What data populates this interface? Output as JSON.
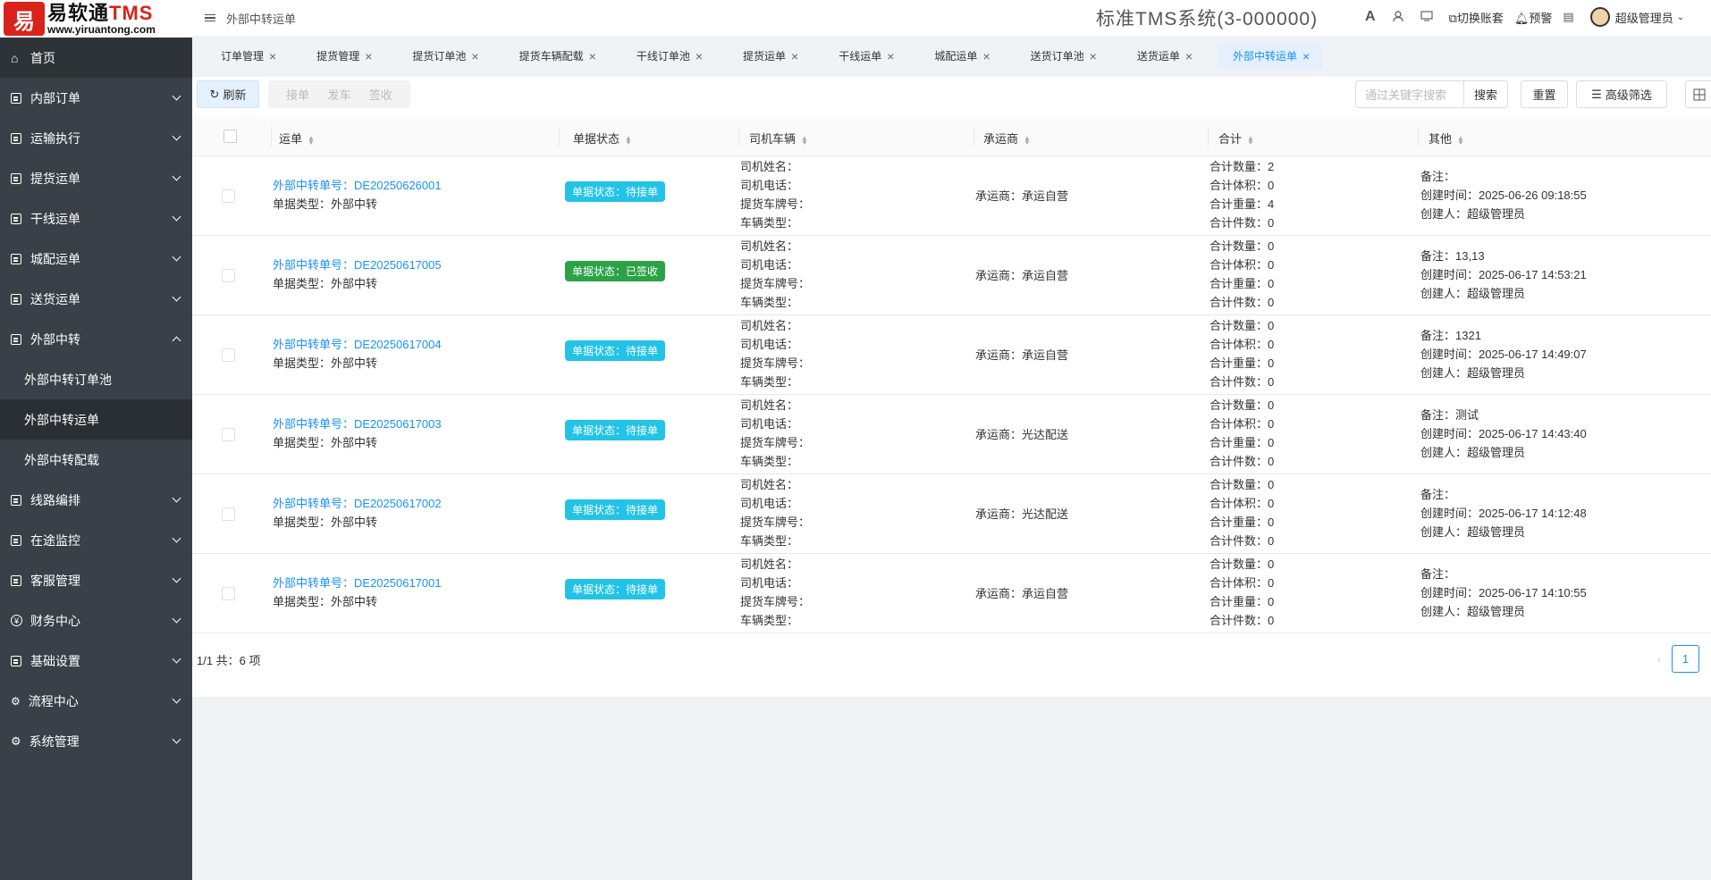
{
  "logo": {
    "mark": "易",
    "name_cn": "易软通",
    "name_en": "TMS",
    "url": "www.yiruantong.com"
  },
  "header": {
    "breadcrumb": "外部中转运单",
    "system_title": "标准TMS系统(3-000000)",
    "font_icon": "A",
    "switch_account": "切换账套",
    "warning": "预警",
    "user": "超级管理员"
  },
  "sidebar": {
    "items": [
      {
        "label": "首页",
        "icon": "home-icon"
      },
      {
        "label": "内部订单",
        "icon": "grid-icon"
      },
      {
        "label": "运输执行",
        "icon": "grid-icon"
      },
      {
        "label": "提货运单",
        "icon": "grid-icon"
      },
      {
        "label": "干线运单",
        "icon": "grid-icon"
      },
      {
        "label": "城配运单",
        "icon": "grid-icon"
      },
      {
        "label": "送货运单",
        "icon": "grid-icon"
      },
      {
        "label": "外部中转",
        "icon": "grid-icon"
      },
      {
        "label": "外部中转订单池"
      },
      {
        "label": "外部中转运单"
      },
      {
        "label": "外部中转配载"
      },
      {
        "label": "线路编排",
        "icon": "grid-icon"
      },
      {
        "label": "在途监控",
        "icon": "grid-icon"
      },
      {
        "label": "客服管理",
        "icon": "grid-icon"
      },
      {
        "label": "财务中心",
        "icon": "yen-icon"
      },
      {
        "label": "基础设置",
        "icon": "grid-icon"
      },
      {
        "label": "流程中心",
        "icon": "flow-icon"
      },
      {
        "label": "系统管理",
        "icon": "gear-icon"
      }
    ]
  },
  "tabs": [
    "订单管理",
    "提货管理",
    "提货订单池",
    "提货车辆配载",
    "干线订单池",
    "提货运单",
    "干线运单",
    "城配运单",
    "送货订单池",
    "送货运单",
    "外部中转运单"
  ],
  "toolbar": {
    "refresh": "刷新",
    "accept": "接单",
    "dispatch": "发车",
    "sign": "签收",
    "search_placeholder": "通过关键字搜索",
    "search": "搜索",
    "reset": "重置",
    "advanced_filter": "高级筛选"
  },
  "table": {
    "headers": [
      "运单",
      "单据状态",
      "司机车辆",
      "承运商",
      "合计",
      "其他"
    ],
    "labels": {
      "order_no": "外部中转单号：",
      "order_type": "单据类型：",
      "driver_name": "司机姓名：",
      "driver_phone": "司机电话：",
      "plate": "提货车牌号：",
      "vehicle_type": "车辆类型：",
      "carrier": "承运商：",
      "qty": "合计数量：",
      "volume": "合计体积：",
      "weight": "合计重量：",
      "pieces": "合计件数：",
      "remark": "备注：",
      "created_at": "创建时间：",
      "creator": "创建人："
    },
    "rows": [
      {
        "no": "DE20250626001",
        "type": "外部中转",
        "status": "单据状态：待接单",
        "carrier": "承运自营",
        "qty": "2",
        "volume": "0",
        "weight": "4",
        "pieces": "0",
        "remark": "",
        "created": "2025-06-26 09:18:55",
        "creator": "超级管理员"
      },
      {
        "no": "DE20250617005",
        "type": "外部中转",
        "status": "单据状态：已签收",
        "carrier": "承运自营",
        "qty": "0",
        "volume": "0",
        "weight": "0",
        "pieces": "0",
        "remark": "13,13",
        "created": "2025-06-17 14:53:21",
        "creator": "超级管理员"
      },
      {
        "no": "DE20250617004",
        "type": "外部中转",
        "status": "单据状态：待接单",
        "carrier": "承运自营",
        "qty": "0",
        "volume": "0",
        "weight": "0",
        "pieces": "0",
        "remark": "1321",
        "created": "2025-06-17 14:49:07",
        "creator": "超级管理员"
      },
      {
        "no": "DE20250617003",
        "type": "外部中转",
        "status": "单据状态：待接单",
        "carrier": "光达配送",
        "qty": "0",
        "volume": "0",
        "weight": "0",
        "pieces": "0",
        "remark": "测试",
        "created": "2025-06-17 14:43:40",
        "creator": "超级管理员"
      },
      {
        "no": "DE20250617002",
        "type": "外部中转",
        "status": "单据状态：待接单",
        "carrier": "光达配送",
        "qty": "0",
        "volume": "0",
        "weight": "0",
        "pieces": "0",
        "remark": "",
        "created": "2025-06-17 14:12:48",
        "creator": "超级管理员"
      },
      {
        "no": "DE20250617001",
        "type": "外部中转",
        "status": "单据状态：待接单",
        "carrier": "承运自营",
        "qty": "0",
        "volume": "0",
        "weight": "0",
        "pieces": "0",
        "remark": "",
        "created": "2025-06-17 14:10:55",
        "creator": "超级管理员"
      }
    ]
  },
  "pagination": {
    "summary": "1/1 共：6 项",
    "current": "1"
  },
  "colors": {
    "primary": "#1890ff",
    "sidebar": "#3a4047",
    "badge_pending": "#22c3e6",
    "badge_signed": "#2ba245",
    "brand_red": "#d9221a"
  }
}
